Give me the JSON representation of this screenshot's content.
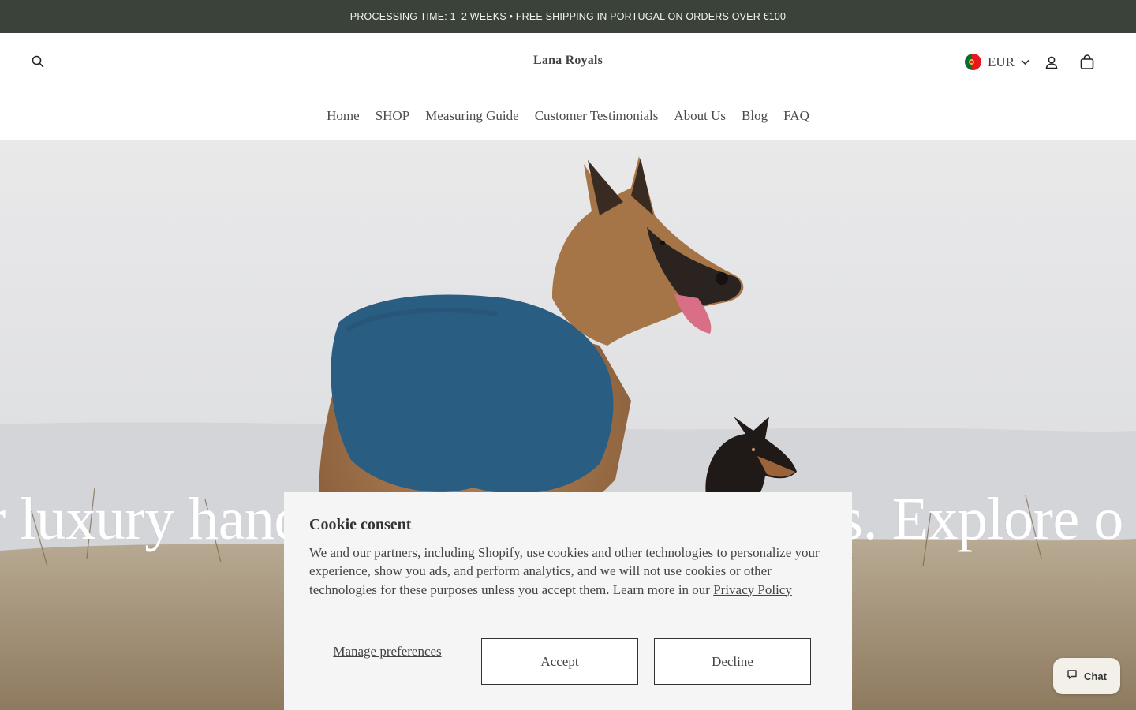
{
  "announcement": {
    "text": "PROCESSING TIME: 1–2 WEEKS • FREE SHIPPING IN PORTUGAL ON ORDERS OVER €100"
  },
  "header": {
    "logo": "Lana Royals",
    "currency": "EUR",
    "icons": {
      "search": "search-icon",
      "account": "account-icon",
      "cart": "cart-icon",
      "flag": "portugal-flag-icon",
      "chevron": "chevron-down-icon"
    }
  },
  "nav": {
    "items": [
      {
        "label": "Home"
      },
      {
        "label": "SHOP"
      },
      {
        "label": "Measuring Guide"
      },
      {
        "label": "Customer Testimonials"
      },
      {
        "label": "About Us"
      },
      {
        "label": "Blog"
      },
      {
        "label": "FAQ"
      }
    ]
  },
  "hero": {
    "marquee_text": "r luxury handmade knitwear for dogs. Explore o"
  },
  "cookie": {
    "title": "Cookie consent",
    "body": "We and our partners, including Shopify, use cookies and other technologies to personalize your experience, show you ads, and perform analytics, and we will not use cookies or other technologies for these purposes unless you accept them. Learn more in our ",
    "privacy_link": "Privacy Policy",
    "manage_label": "Manage preferences",
    "accept_label": "Accept",
    "decline_label": "Decline"
  },
  "chat": {
    "label": "Chat",
    "icon": "chat-bubble-icon"
  },
  "colors": {
    "announcement_bg": "#3b4239",
    "cookie_bg": "#f5f5f5",
    "sweater": "#2a5d82"
  }
}
